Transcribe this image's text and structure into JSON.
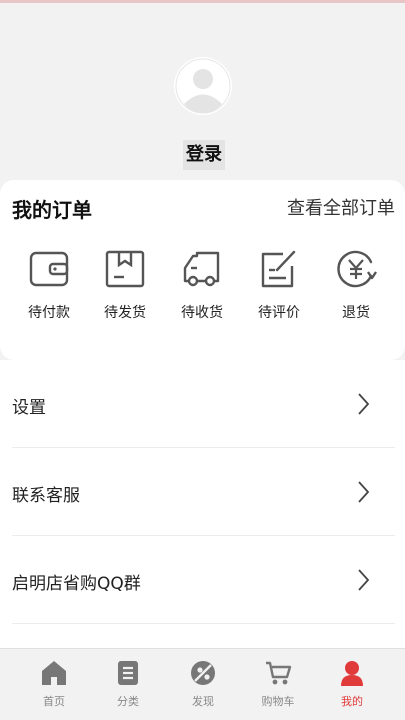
{
  "profile": {
    "login_label": "登录"
  },
  "orders": {
    "title": "我的订单",
    "view_all": "查看全部订单",
    "items": [
      {
        "label": "待付款",
        "icon": "wallet-icon"
      },
      {
        "label": "待发货",
        "icon": "package-icon"
      },
      {
        "label": "待收货",
        "icon": "truck-icon"
      },
      {
        "label": "待评价",
        "icon": "review-icon"
      },
      {
        "label": "退货",
        "icon": "refund-icon"
      }
    ]
  },
  "menu": {
    "items": [
      {
        "label": "设置"
      },
      {
        "label": "联系客服"
      },
      {
        "label": "启明店省购QQ群"
      }
    ]
  },
  "tabbar": {
    "items": [
      {
        "label": "首页",
        "icon": "home-icon"
      },
      {
        "label": "分类",
        "icon": "category-icon"
      },
      {
        "label": "发现",
        "icon": "discover-icon"
      },
      {
        "label": "购物车",
        "icon": "cart-icon"
      },
      {
        "label": "我的",
        "icon": "user-icon"
      }
    ],
    "active_index": 4
  },
  "colors": {
    "accent": "#e03a3a",
    "icon_gray": "#555555",
    "tab_gray": "#888888"
  }
}
